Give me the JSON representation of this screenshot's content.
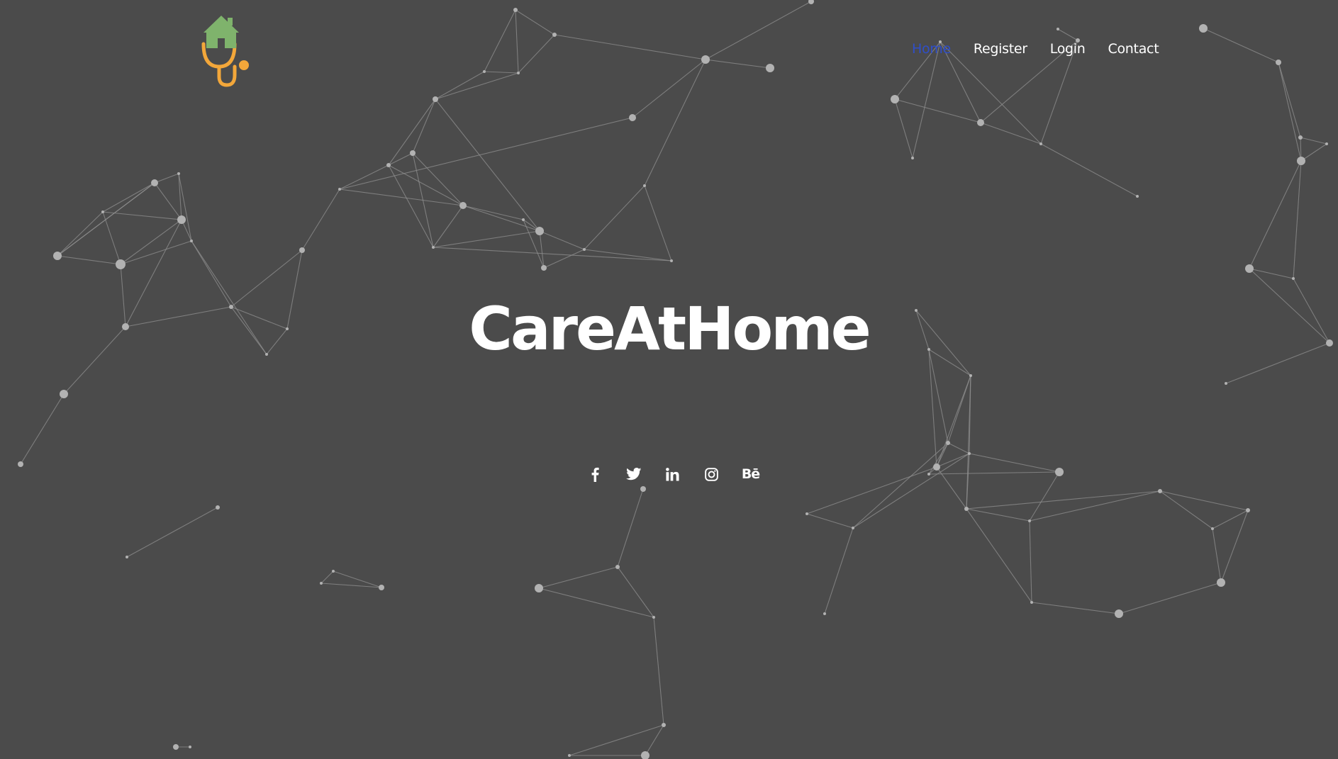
{
  "nav": {
    "items": [
      {
        "label": "Home",
        "active": true
      },
      {
        "label": "Register",
        "active": false
      },
      {
        "label": "Login",
        "active": false
      },
      {
        "label": "Contact",
        "active": false
      }
    ]
  },
  "hero": {
    "title": "CareAtHome"
  },
  "social": {
    "behance_label": "Bē",
    "icons": [
      "facebook-icon",
      "twitter-icon",
      "linkedin-icon",
      "instagram-icon",
      "behance-icon"
    ]
  },
  "colors": {
    "background": "#4b4b4b",
    "nav_active": "#2f4ec9",
    "text": "#ffffff",
    "logo_house": "#7fb36c",
    "logo_stethoscope": "#f3a73a"
  }
}
